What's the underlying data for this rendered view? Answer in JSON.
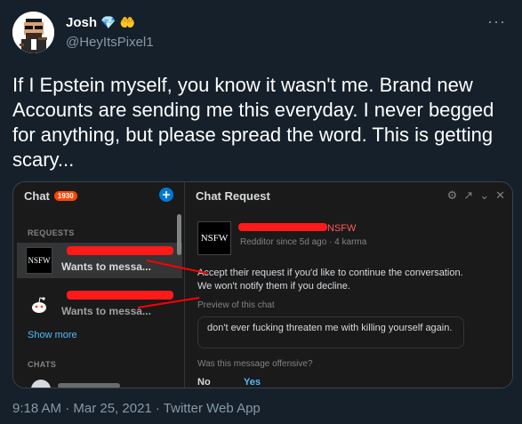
{
  "author": {
    "name": "Josh",
    "badges": [
      "diamond-emoji",
      "palms-up-emoji"
    ],
    "handle": "@HeyItsPixel1"
  },
  "tweet": {
    "text": "If I Epstein myself, you know it wasn't me. Brand new Accounts are sending me this everyday. I never begged for anything, but please spread the word. This is getting scary...",
    "timestamp": "9:18 AM · Mar 25, 2021 · Twitter Web App"
  },
  "more_icon": "ellipsis-icon",
  "screenshot": {
    "left": {
      "title": "Chat",
      "badge": "1930",
      "requests_label": "REQUESTS",
      "requests": [
        {
          "avatar": "NSFW",
          "message": "Wants to messa..."
        },
        {
          "avatar": "snoo",
          "message": "Wants to messa..."
        }
      ],
      "show_more": "Show more",
      "chats_label": "CHATS"
    },
    "right": {
      "title": "Chat Request",
      "avatar_text": "NSFW",
      "username_suffix": "NSFW",
      "meta": "Redditor since 5d ago · 4 karma",
      "info": "Accept their request if you'd like to continue the conversation. We won't notify them if you decline.",
      "preview_label": "Preview of this chat",
      "preview_message": "don't ever fucking threaten me with killing yourself again.",
      "offensive_question": "Was this message offensive?",
      "no_label": "No",
      "yes_label": "Yes",
      "header_icons": [
        "settings-icon",
        "popout-icon",
        "minimize-icon",
        "close-icon"
      ]
    }
  },
  "colors": {
    "background": "#15202b",
    "secondary_text": "#8899a6",
    "reddit_bg": "#1a1a1b",
    "reddit_link": "#4fbcff",
    "redaction": "#ff0000"
  }
}
